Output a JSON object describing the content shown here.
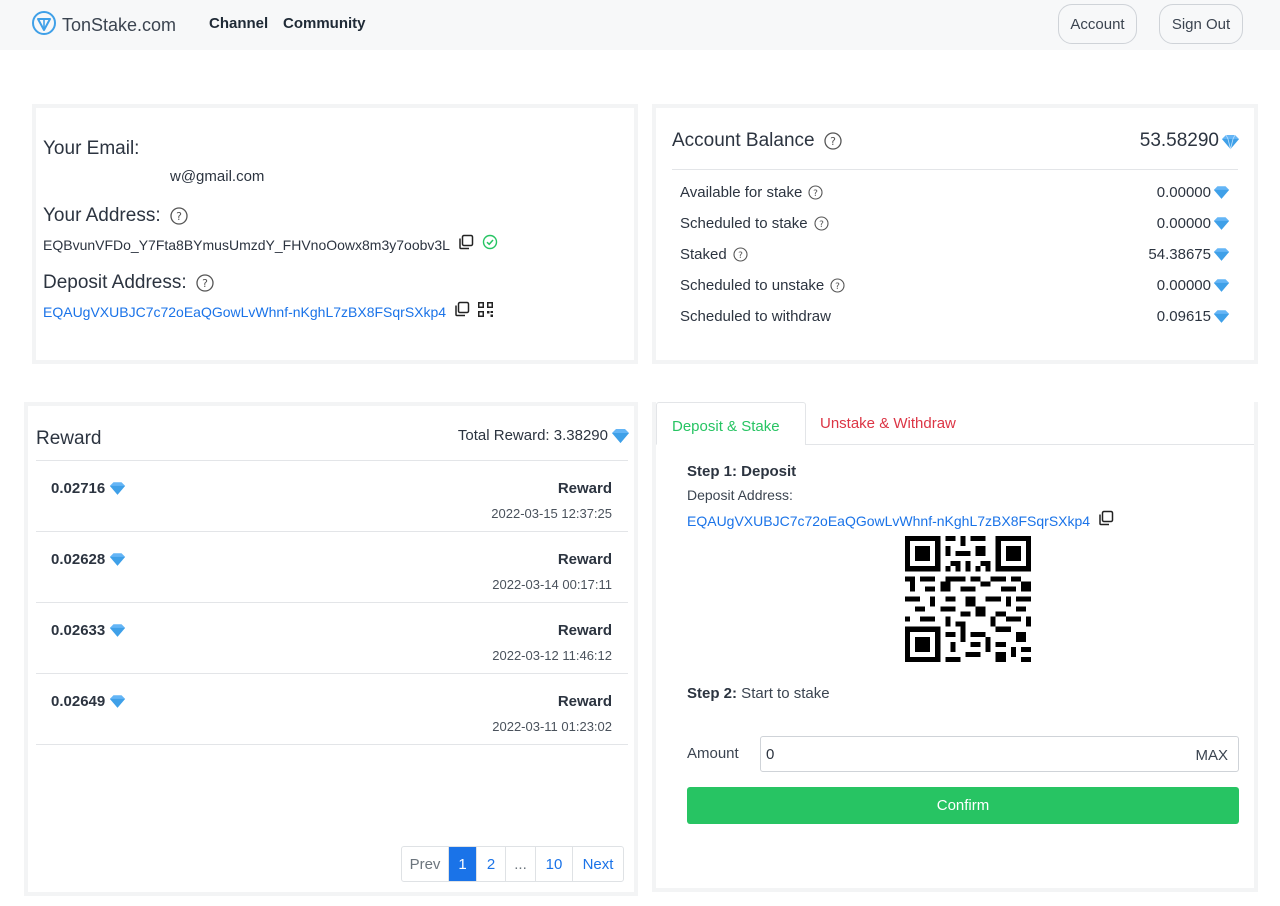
{
  "header": {
    "brand": "TonStake.com",
    "nav": [
      "Channel",
      "Community"
    ],
    "account_label": "Account",
    "signout_label": "Sign Out"
  },
  "profile": {
    "email_label": "Your Email:",
    "email": "w@gmail.com",
    "address_label": "Your Address:",
    "address": "EQBvunVFDo_Y7Fta8BYmusUmzdY_FHVnoOowx8m3y7oobv3L",
    "deposit_label": "Deposit Address:",
    "deposit_address": "EQAUgVXUBJC7c72oEaQGowLvWhnf-nKghL7zBX8FSqrSXkp4"
  },
  "balance": {
    "title": "Account Balance",
    "total": "53.58290",
    "rows": [
      {
        "label": "Available for stake",
        "value": "0.00000",
        "help": true
      },
      {
        "label": "Scheduled to stake",
        "value": "0.00000",
        "help": true
      },
      {
        "label": "Staked",
        "value": "54.38675",
        "help": true
      },
      {
        "label": "Scheduled to unstake",
        "value": "0.00000",
        "help": true
      },
      {
        "label": "Scheduled to withdraw",
        "value": "0.09615",
        "help": false
      }
    ]
  },
  "reward": {
    "title": "Reward",
    "total_label": "Total Reward: 3.38290",
    "items": [
      {
        "amount": "0.02716",
        "type": "Reward",
        "time": "2022-03-15 12:37:25"
      },
      {
        "amount": "0.02628",
        "type": "Reward",
        "time": "2022-03-14 00:17:11"
      },
      {
        "amount": "0.02633",
        "type": "Reward",
        "time": "2022-03-12 11:46:12"
      },
      {
        "amount": "0.02649",
        "type": "Reward",
        "time": "2022-03-11 01:23:02"
      }
    ],
    "pager": {
      "prev": "Prev",
      "pages": [
        "1",
        "2",
        "...",
        "10"
      ],
      "next": "Next"
    }
  },
  "stake": {
    "tabs": [
      "Deposit & Stake",
      "Unstake & Withdraw"
    ],
    "step1_title": "Step 1: Deposit",
    "deposit_label": "Deposit Address:",
    "deposit_address": "EQAUgVXUBJC7c72oEaQGowLvWhnf-nKghL7zBX8FSqrSXkp4",
    "step2_prefix": "Step 2:",
    "step2_text": " Start to stake",
    "amount_label": "Amount",
    "amount_value": "0",
    "max_label": "MAX",
    "confirm_label": "Confirm"
  },
  "colors": {
    "green": "#27c463",
    "blue": "#1a73e8",
    "red": "#dc3545",
    "gem": "#3fa0e8"
  }
}
